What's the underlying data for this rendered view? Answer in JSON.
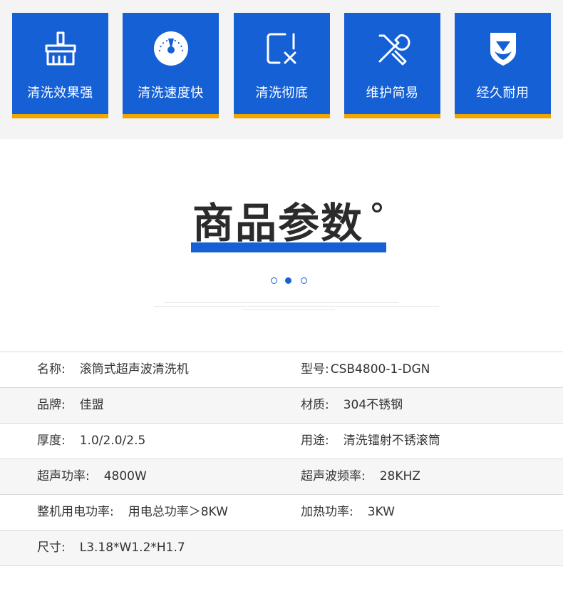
{
  "features": [
    {
      "label": "清洗效果强",
      "icon": "broom-icon"
    },
    {
      "label": "清洗速度快",
      "icon": "speedometer-icon"
    },
    {
      "label": "清洗彻底",
      "icon": "clean-box-x-icon"
    },
    {
      "label": "维护简易",
      "icon": "wrench-screwdriver-icon"
    },
    {
      "label": "经久耐用",
      "icon": "shield-icon"
    }
  ],
  "colors": {
    "accent_blue": "#1660d6",
    "accent_orange": "#f0a500",
    "title_text": "#2b2b2b"
  },
  "section": {
    "title": "商品参数"
  },
  "specs": {
    "rows": [
      {
        "left_key": "名称:",
        "left_val": "滚筒式超声波清洗机",
        "right_key": "型号:",
        "right_val": "CSB4800-1-DGN"
      },
      {
        "left_key": "品牌:",
        "left_val": "佳盟",
        "right_key": "材质:",
        "right_val": "304不锈钢"
      },
      {
        "left_key": "厚度:",
        "left_val": "1.0/2.0/2.5",
        "right_key": "用途:",
        "right_val": "清洗镭射不锈滚筒"
      },
      {
        "left_key": "超声功率:",
        "left_val": "4800W",
        "right_key": "超声波频率:",
        "right_val": "28KHZ"
      },
      {
        "left_key": "整机用电功率:",
        "left_val": "用电总功率＞8KW",
        "right_key": "加热功率:",
        "right_val": "3KW"
      },
      {
        "left_key": "尺寸:",
        "left_val": "L3.18*W1.2*H1.7",
        "right_key": "",
        "right_val": ""
      }
    ]
  }
}
